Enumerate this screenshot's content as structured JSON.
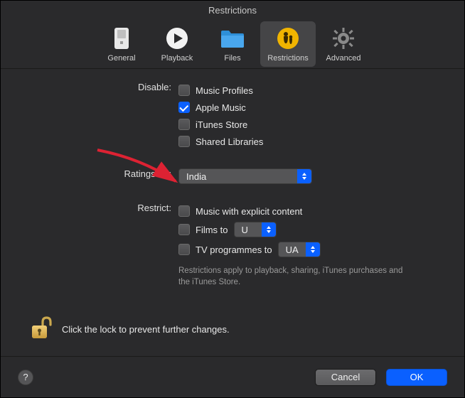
{
  "window": {
    "title": "Restrictions"
  },
  "toolbar": {
    "items": [
      {
        "label": "General"
      },
      {
        "label": "Playback"
      },
      {
        "label": "Files"
      },
      {
        "label": "Restrictions"
      },
      {
        "label": "Advanced"
      }
    ]
  },
  "disable": {
    "heading": "Disable:",
    "items": [
      {
        "label": "Music Profiles",
        "checked": false
      },
      {
        "label": "Apple Music",
        "checked": true
      },
      {
        "label": "iTunes Store",
        "checked": false
      },
      {
        "label": "Shared Libraries",
        "checked": false
      }
    ]
  },
  "ratings": {
    "heading": "Ratings for:",
    "value": "India"
  },
  "restrict": {
    "heading": "Restrict:",
    "explicit_label": "Music with explicit content",
    "films_label": "Films to",
    "films_value": "U",
    "tv_label": "TV programmes to",
    "tv_value": "UA",
    "note": "Restrictions apply to playback, sharing, iTunes purchases and the iTunes Store."
  },
  "lock": {
    "text": "Click the lock to prevent further changes."
  },
  "buttons": {
    "help": "?",
    "cancel": "Cancel",
    "ok": "OK"
  }
}
